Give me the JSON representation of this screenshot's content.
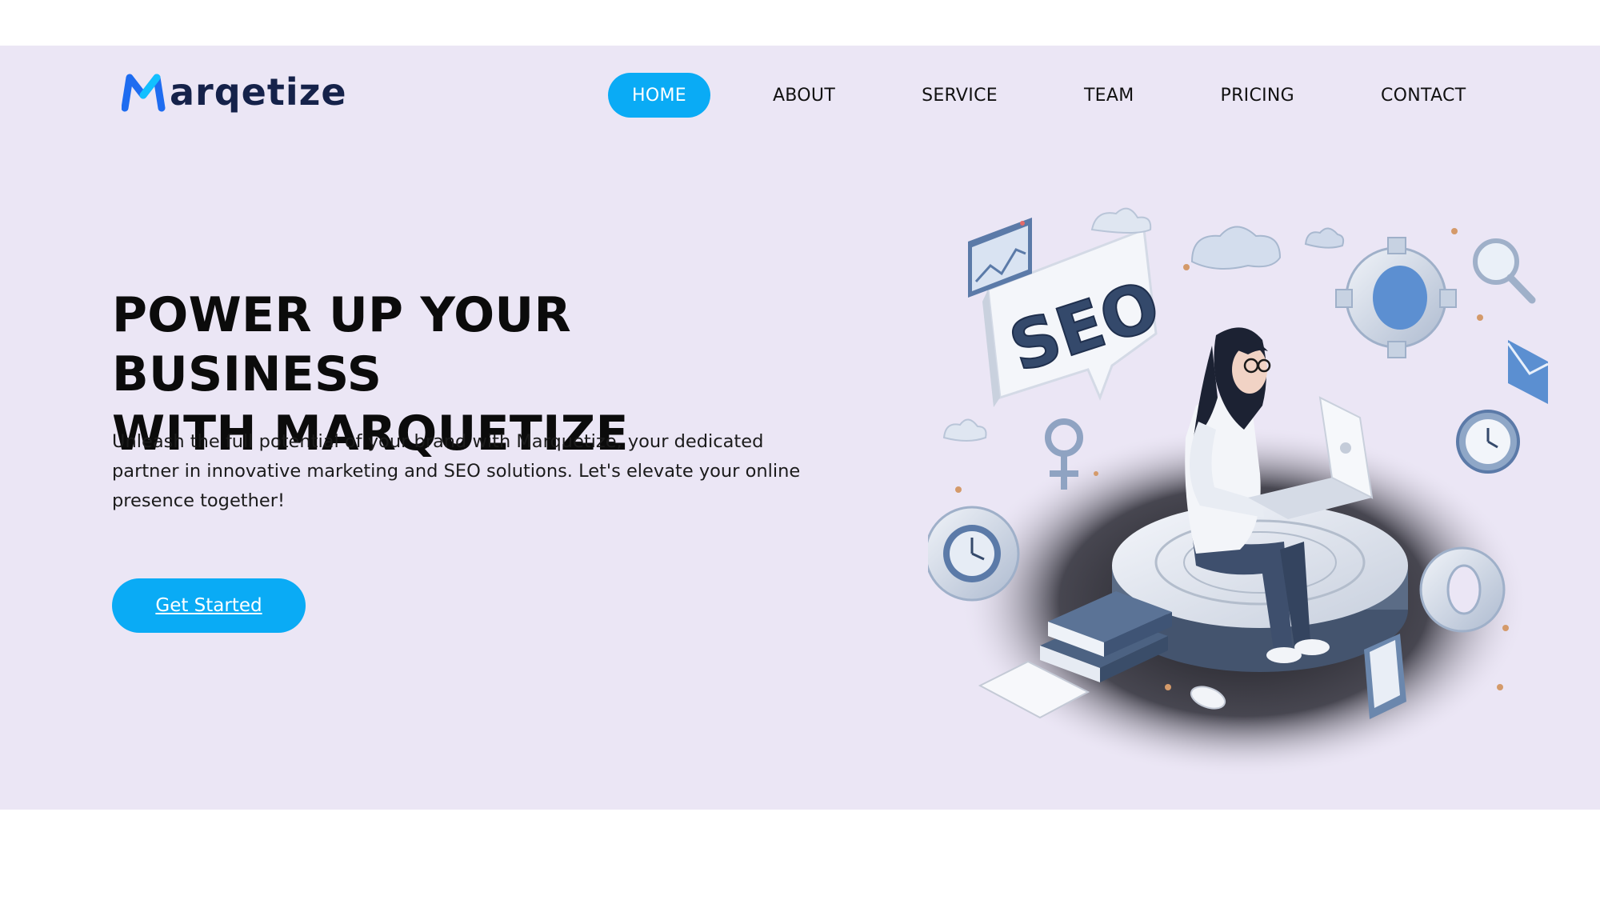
{
  "brand": {
    "name": "Marqetize",
    "name_rest": "arqetize",
    "logo_mark": "M",
    "colors": {
      "primary": "#0aabf5",
      "logo_dark": "#15224a",
      "logo_blue": "#1e6cf0"
    }
  },
  "nav": {
    "items": [
      {
        "label": "HOME",
        "active": true
      },
      {
        "label": "ABOUT",
        "active": false
      },
      {
        "label": "SERVICE",
        "active": false
      },
      {
        "label": "TEAM",
        "active": false
      },
      {
        "label": "PRICING",
        "active": false
      },
      {
        "label": "CONTACT",
        "active": false
      }
    ]
  },
  "hero": {
    "headline_line1": "POWER UP YOUR BUSINESS",
    "headline_line2": "WITH MARQUETIZE",
    "description": "Unleash the full potential of your brand with Marquetize, your dedicated partner in innovative marketing and SEO solutions. Let's elevate your online presence together!",
    "cta_label": "Get Started",
    "background": "#ebe6f5",
    "illustration": {
      "subject": "person-with-laptop-seo-illustration",
      "badge_text": "SEO"
    }
  }
}
